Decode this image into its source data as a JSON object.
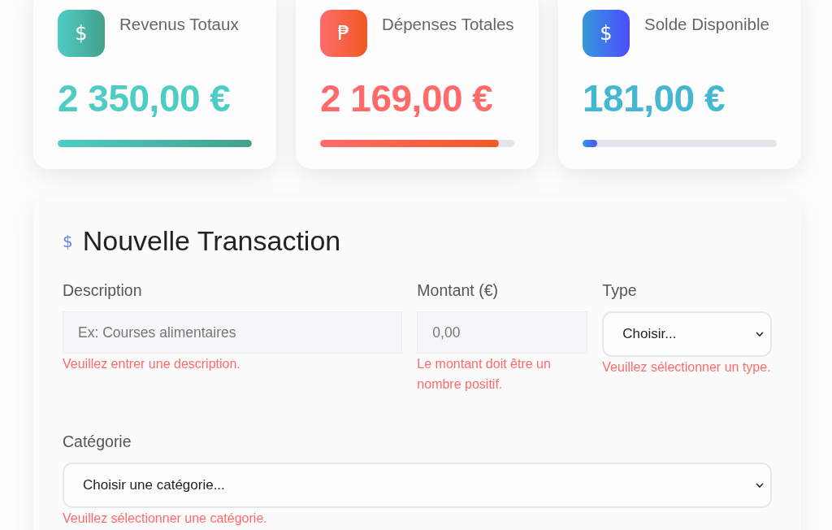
{
  "summary_cards": [
    {
      "kind": "income",
      "icon": "$",
      "title": "Revenus Totaux",
      "amount": "2 350,00 €",
      "level": 1
    },
    {
      "kind": "expense",
      "icon": "₱",
      "title": "Dépenses Totales",
      "amount": "2 169,00 €",
      "level": 0.92
    },
    {
      "kind": "balance",
      "icon": "$",
      "title": "Solde Disponible",
      "amount": "181,00 €",
      "level": 0.077
    }
  ],
  "form": {
    "icon": "$",
    "title": "Nouvelle Transaction",
    "rows": [
      [
        {
          "kind": "text",
          "label": "Description",
          "placeholder": "Ex: Courses alimentaires",
          "error": "Veuillez entrer une description."
        },
        {
          "kind": "text",
          "label": "Montant (€)",
          "placeholder": "0,00",
          "error": "Le montant doit être un nombre positif."
        },
        {
          "kind": "select",
          "label": "Type",
          "value": "Choisir...",
          "error": "Veuillez sélectionner un type."
        }
      ],
      [
        {
          "kind": "select",
          "label": "Catégorie",
          "value": "Choisir une catégorie...",
          "error": "Veuillez sélectionner une catégorie."
        }
      ]
    ]
  }
}
